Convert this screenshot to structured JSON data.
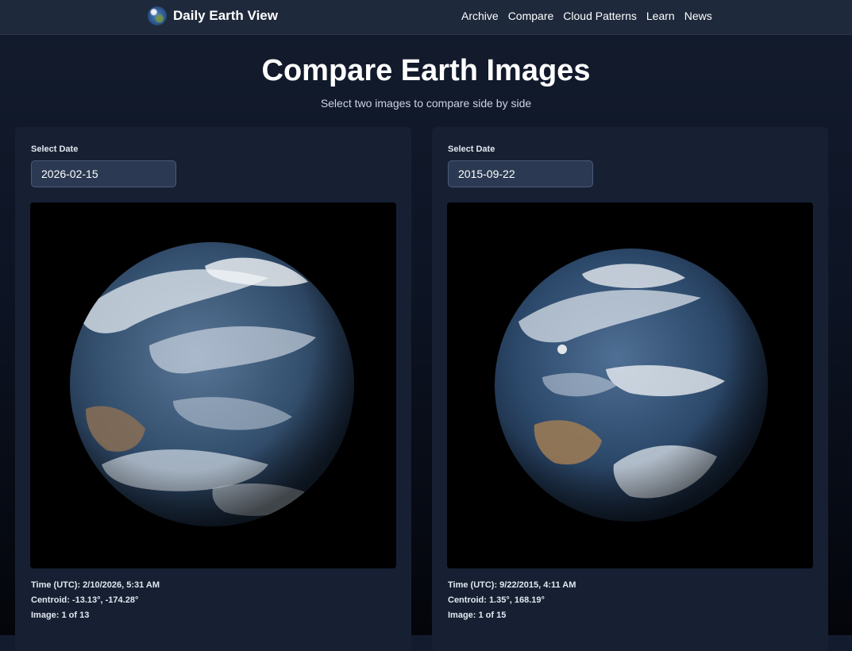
{
  "nav": {
    "brand": "Daily Earth View",
    "brand_icon": "globe-icon",
    "links": [
      "Archive",
      "Compare",
      "Cloud Patterns",
      "Learn",
      "News"
    ]
  },
  "header": {
    "title": "Compare Earth Images",
    "subtitle": "Select two images to compare side by side"
  },
  "panels": [
    {
      "select_label": "Select Date",
      "date_value": "2026-02-15",
      "time": "Time (UTC): 2/10/2026, 5:31 AM",
      "centroid": "Centroid: -13.13°, -174.28°",
      "image_count": "Image: 1 of 13"
    },
    {
      "select_label": "Select Date",
      "date_value": "2015-09-22",
      "time": "Time (UTC): 9/22/2015, 4:11 AM",
      "centroid": "Centroid: 1.35°, 168.19°",
      "image_count": "Image: 1 of 15"
    }
  ],
  "colors": {
    "nav_bg": "#1e293b",
    "panel_bg": "#172033",
    "input_bg": "#2b3a52",
    "ocean": "#2a4a6e",
    "land": "#8a6f55"
  }
}
